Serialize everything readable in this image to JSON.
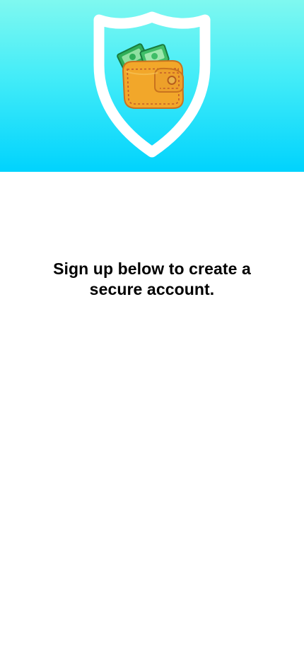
{
  "hero": {
    "icons": [
      "shield-icon",
      "wallet-icon",
      "cash-icon"
    ],
    "gradient_top": "#7ff8f0",
    "gradient_bottom": "#00d3fd"
  },
  "signup": {
    "headline": "Sign up below to create a secure account."
  },
  "colors": {
    "background": "#ffffff",
    "text": "#000000",
    "shield": "#ffffff",
    "wallet": "#f2a72a",
    "cash": "#4cc56f"
  }
}
